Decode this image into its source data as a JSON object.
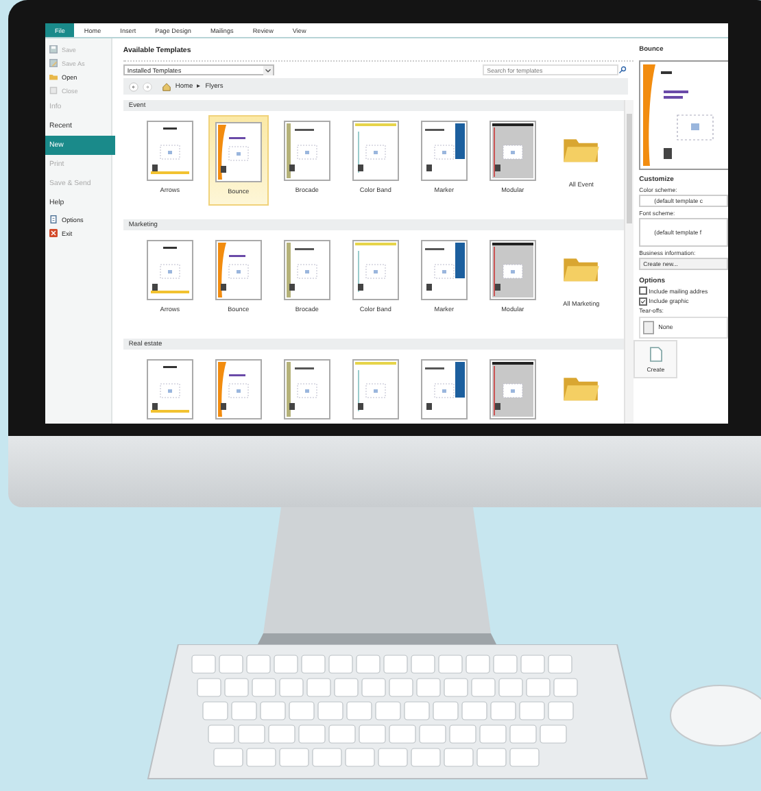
{
  "ribbon_tabs": [
    {
      "label": "File",
      "selected": true
    },
    {
      "label": "Home",
      "selected": false
    },
    {
      "label": "Insert",
      "selected": false
    },
    {
      "label": "Page Design",
      "selected": false
    },
    {
      "label": "Mailings",
      "selected": false
    },
    {
      "label": "Review",
      "selected": false
    },
    {
      "label": "View",
      "selected": false
    }
  ],
  "backstage_menu": [
    {
      "label": "Save",
      "kind": "save",
      "disabled": true
    },
    {
      "label": "Save As",
      "kind": "save-as",
      "disabled": true
    },
    {
      "label": "Open",
      "kind": "open",
      "disabled": false
    },
    {
      "label": "Close",
      "kind": "close",
      "disabled": true
    },
    {
      "label": "Info",
      "kind": "tab",
      "disabled": true,
      "selected": false
    },
    {
      "label": "Recent",
      "kind": "tab",
      "disabled": false,
      "selected": false
    },
    {
      "label": "New",
      "kind": "tab",
      "disabled": false,
      "selected": true
    },
    {
      "label": "Print",
      "kind": "tab",
      "disabled": true,
      "selected": false
    },
    {
      "label": "Save & Send",
      "kind": "tab",
      "disabled": true,
      "selected": false
    },
    {
      "label": "Help",
      "kind": "tab",
      "disabled": false,
      "selected": false
    },
    {
      "label": "Options",
      "kind": "options",
      "disabled": false
    },
    {
      "label": "Exit",
      "kind": "exit",
      "disabled": false
    }
  ],
  "gallery": {
    "title": "Available Templates",
    "source_dropdown": "Installed Templates",
    "search": {
      "placeholder": "Search for templates"
    },
    "breadcrumb": {
      "home": "Home",
      "separator": "▸",
      "current": "Flyers"
    },
    "sections": [
      {
        "heading": "Event",
        "templates": [
          {
            "label": "Arrows",
            "kind": "arrows",
            "selected": false
          },
          {
            "label": "Bounce",
            "kind": "bounce",
            "selected": true
          },
          {
            "label": "Brocade",
            "kind": "brocade",
            "selected": false
          },
          {
            "label": "Color Band",
            "kind": "colorband",
            "selected": false
          },
          {
            "label": "Marker",
            "kind": "marker",
            "selected": false
          },
          {
            "label": "Modular",
            "kind": "modular",
            "selected": false
          },
          {
            "label": "All Event",
            "kind": "folder",
            "selected": false
          }
        ]
      },
      {
        "heading": "Marketing",
        "templates": [
          {
            "label": "Arrows",
            "kind": "arrows",
            "selected": false
          },
          {
            "label": "Bounce",
            "kind": "bounce",
            "selected": false
          },
          {
            "label": "Brocade",
            "kind": "brocade",
            "selected": false
          },
          {
            "label": "Color Band",
            "kind": "colorband",
            "selected": false
          },
          {
            "label": "Marker",
            "kind": "marker",
            "selected": false
          },
          {
            "label": "Modular",
            "kind": "modular",
            "selected": false
          },
          {
            "label": "All Marketing",
            "kind": "folder",
            "selected": false
          }
        ]
      },
      {
        "heading": "Real estate",
        "templates": [
          {
            "kind": "arrows",
            "selected": false
          },
          {
            "kind": "bounce",
            "selected": false
          },
          {
            "kind": "brocade",
            "selected": false
          },
          {
            "kind": "colorband",
            "selected": false
          },
          {
            "kind": "marker",
            "selected": false
          },
          {
            "kind": "modular",
            "selected": false
          },
          {
            "kind": "folder",
            "selected": false
          }
        ]
      }
    ]
  },
  "preview_panel": {
    "title": "Bounce",
    "customize_heading": "Customize",
    "color_scheme_label": "Color scheme:",
    "color_scheme_value": "(default template c",
    "font_scheme_label": "Font scheme:",
    "font_scheme_value": "(default template f",
    "business_label": "Business information:",
    "business_value": "Create new...",
    "options_heading": "Options",
    "options": [
      {
        "label": "Include mailing addres",
        "checked": false
      },
      {
        "label": "Include graphic",
        "checked": true
      }
    ],
    "tearoffs_label": "Tear-offs:",
    "tearoffs_value": "None",
    "create_button": "Create"
  }
}
